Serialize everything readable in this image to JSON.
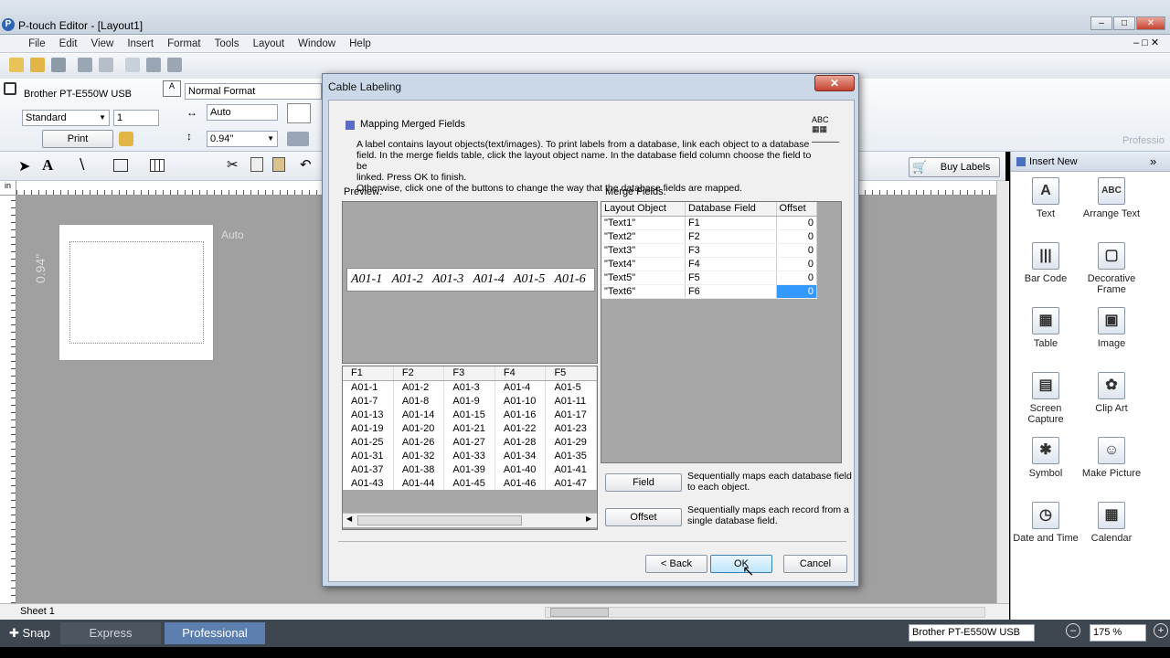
{
  "window": {
    "title": "P-touch Editor - [Layout1]"
  },
  "menu": [
    "File",
    "Edit",
    "View",
    "Insert",
    "Format",
    "Tools",
    "Layout",
    "Window",
    "Help"
  ],
  "printer_panel": {
    "printer": "Brother PT-E550W USB",
    "mode": "Standard",
    "copies": "1",
    "print_label": "Print"
  },
  "format_panel": {
    "style": "Normal Format",
    "length": "Auto",
    "width": "0.94\""
  },
  "canvas": {
    "label_length": "Auto",
    "label_width": "0.94\"",
    "sheet_tab": "Sheet 1"
  },
  "buy_labels": "Buy Labels",
  "insert_panel": {
    "title": "Insert New",
    "items": [
      {
        "label": "Text",
        "icon": "text-icon"
      },
      {
        "label": "Arrange Text",
        "icon": "arrange-text-icon"
      },
      {
        "label": "Bar Code",
        "icon": "barcode-icon"
      },
      {
        "label": "Decorative Frame",
        "icon": "frame-icon"
      },
      {
        "label": "Table",
        "icon": "table-icon"
      },
      {
        "label": "Image",
        "icon": "image-icon"
      },
      {
        "label": "Screen Capture",
        "icon": "screen-capture-icon"
      },
      {
        "label": "Clip Art",
        "icon": "clip-art-icon"
      },
      {
        "label": "Symbol",
        "icon": "symbol-icon"
      },
      {
        "label": "Make Picture",
        "icon": "make-picture-icon"
      },
      {
        "label": "Date and Time",
        "icon": "clock-icon"
      },
      {
        "label": "Calendar",
        "icon": "calendar-icon"
      }
    ]
  },
  "watermark": "Professio",
  "status": {
    "snap": "Snap",
    "tab_express": "Express",
    "tab_professional": "Professional",
    "printer": "Brother PT-E550W USB",
    "zoom": "175 %"
  },
  "dialog": {
    "title": "Cable Labeling",
    "section": "Mapping Merged Fields",
    "description_1": "A label contains layout objects(text/images). To print labels from a database, link each object to a database",
    "description_2": "field. In the merge fields table, click the layout object name. In the database field column choose the field to be",
    "description_3": "linked. Press OK to finish.",
    "description_4": "Otherwise, click one of the buttons to change the way that the database fields are mapped.",
    "preview_label": "Preview:",
    "merge_label": "Merge Fields:",
    "preview_strip": [
      "A01-1",
      "A01-2",
      "A01-3",
      "A01-4",
      "A01-5",
      "A01-6"
    ],
    "db_headers": [
      "F1",
      "F2",
      "F3",
      "F4",
      "F5"
    ],
    "db_rows": [
      [
        "A01-1",
        "A01-2",
        "A01-3",
        "A01-4",
        "A01-5"
      ],
      [
        "A01-7",
        "A01-8",
        "A01-9",
        "A01-10",
        "A01-11"
      ],
      [
        "A01-13",
        "A01-14",
        "A01-15",
        "A01-16",
        "A01-17"
      ],
      [
        "A01-19",
        "A01-20",
        "A01-21",
        "A01-22",
        "A01-23"
      ],
      [
        "A01-25",
        "A01-26",
        "A01-27",
        "A01-28",
        "A01-29"
      ],
      [
        "A01-31",
        "A01-32",
        "A01-33",
        "A01-34",
        "A01-35"
      ],
      [
        "A01-37",
        "A01-38",
        "A01-39",
        "A01-40",
        "A01-41"
      ],
      [
        "A01-43",
        "A01-44",
        "A01-45",
        "A01-46",
        "A01-47"
      ]
    ],
    "merge_headers": [
      "Layout Object",
      "Database Field",
      "Offset"
    ],
    "merge_rows": [
      [
        "\"Text1\"",
        "F1",
        "0"
      ],
      [
        "\"Text2\"",
        "F2",
        "0"
      ],
      [
        "\"Text3\"",
        "F3",
        "0"
      ],
      [
        "\"Text4\"",
        "F4",
        "0"
      ],
      [
        "\"Text5\"",
        "F5",
        "0"
      ],
      [
        "\"Text6\"",
        "F6",
        "0"
      ]
    ],
    "field_button": "Field",
    "field_desc": "Sequentially maps each database field to each object.",
    "offset_button": "Offset",
    "offset_desc": "Sequentially maps each record from a single database field.",
    "back_button": "< Back",
    "ok_button": "OK",
    "cancel_button": "Cancel"
  }
}
